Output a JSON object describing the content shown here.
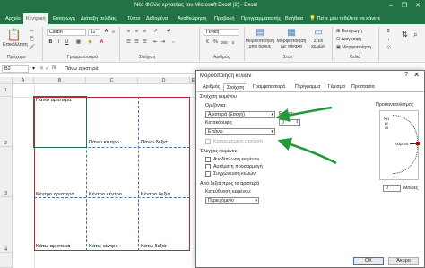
{
  "window": {
    "title": "Νέο Φύλλο εργασίας του Microsoft Excel (2)  -  Excel",
    "controls": [
      "–",
      "❐",
      "✕"
    ]
  },
  "ribbon_tabs": [
    {
      "label": "Αρχείο"
    },
    {
      "label": "Κεντρική"
    },
    {
      "label": "Εισαγωγή"
    },
    {
      "label": "Διάταξη σελίδας"
    },
    {
      "label": "Τύποι"
    },
    {
      "label": "Δεδομένα"
    },
    {
      "label": "Αναθεώρηση"
    },
    {
      "label": "Προβολή"
    },
    {
      "label": "Προγραμματιστής"
    },
    {
      "label": "Βοήθεια"
    }
  ],
  "tell_me": "Πείτε μου τι θέλετε να κάνετε",
  "ribbon": {
    "paste": "Επικόλληση",
    "clipboard": "Πρόχειρο",
    "font_name": "Calibri",
    "font_size": "11",
    "font": "Γραμματοσειρά",
    "alignment": "Στοίχιση",
    "number_format": "Γενική",
    "number": "Αριθμός",
    "conditional": "Μορφοποίηση υπό όρους",
    "as_table": "Μορφοποίηση ως πίνακα",
    "cell_styles": "Στυλ κελιών",
    "styles": "Στυλ",
    "insert": "Εισαγωγή",
    "delete": "Διαγραφή",
    "format": "Μορφοποίηση",
    "cells": "Κελιά",
    "bold": "B",
    "italic": "I",
    "underline": "U"
  },
  "formula_bar": {
    "name_box": "B2",
    "fx": "fx",
    "formula": "Πάνω αριστερά"
  },
  "grid": {
    "columns": [
      "A",
      "B",
      "C",
      "D",
      "E"
    ],
    "rows": [
      "1",
      "2",
      "3",
      "4"
    ],
    "cells": {
      "b2": "Πάνω αριστερά",
      "c2": "Πάνω κέντρο",
      "d2": "Πάνω δεξιά",
      "b3": "Κέντρο αριστερά",
      "c3": "Κέντρο κέντρο",
      "d3": "Κέντρο δεξιά",
      "b4": "Κάτω αριστερά",
      "c4": "Κάτω κέντρο",
      "d4": "Κάτω δεξιά"
    }
  },
  "dialog": {
    "title": "Μορφοποίηση κελιών",
    "help": "?",
    "close": "✕",
    "tabs": [
      {
        "label": "Αριθμός"
      },
      {
        "label": "Στοίχιση"
      },
      {
        "label": "Γραμματοσειρά"
      },
      {
        "label": "Περίγραμμα"
      },
      {
        "label": "Γέμισμα"
      },
      {
        "label": "Προστασία"
      }
    ],
    "text_alignment": "Στοίχιση κειμένου",
    "horizontal_label": "Οριζόντια:",
    "horizontal_value": "Αριστερά (Εσοχή)",
    "indent_label": "Εσοχή:",
    "indent_value": "0",
    "vertical_label": "Κατακόρυφη:",
    "vertical_value": "Επάνω",
    "justify_distributed": "Κατανεμημένη στοίχιση",
    "text_control": "Έλεγχος κειμένου",
    "wrap_text": "Αναδίπλωση κειμένου",
    "shrink_to_fit": "Αυτόματη προσαρμογή",
    "merge_cells": "Συγχώνευση κελιών",
    "rtl": "Από δεξιά προς τα αριστερά",
    "text_direction_label": "Κατεύθυνση κειμένου:",
    "text_direction_value": "Περιεχόμενο",
    "orientation": "Προσανατολισμός",
    "orientation_vertical_text": "Κείμενο",
    "orientation_text": "Κείμενο",
    "degrees_value": "0",
    "degrees_label": "Μοίρες",
    "ok": "OK",
    "cancel": "Άκυρο"
  }
}
